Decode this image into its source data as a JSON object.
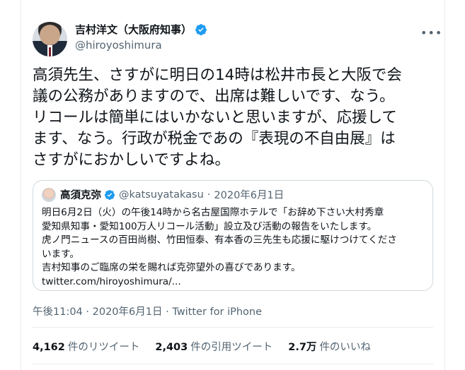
{
  "author": {
    "display_name": "吉村洋文（大阪府知事）",
    "handle": "@hiroyoshimura"
  },
  "more_label": "•••",
  "tweet": {
    "text": "高須先生、さすがに明日の14時は松井市長と大阪で会\n議の公務がありますので、出席は難しいです、なう。\nリコールは簡単にはいかないと思いますが、応援して\nます、なう。行政が税金であの『表現の不自由展』は\nさすがにおかしいですよね。"
  },
  "quoted": {
    "display_name": "高須克弥",
    "handle": "@katsuyatakasu",
    "separator": "·",
    "date": "2020年6月1日",
    "text": "明日6月2日（火）の午後14時から名古屋国際ホテルで「お辞め下さい大村秀章\n愛知県知事・愛知100万人リコール活動」設立及び活動の報告をいたします。\n虎ノ門ニュースの百田尚樹、竹田恒泰、有本香の三先生も応援に駆けつけてくださ\nいます。\n吉村知事のご臨席の栄を賜れば克弥望外の喜びであります。\ntwitter.com/hiroyoshimura/..."
  },
  "timestamp": {
    "time": "午後11:04",
    "separator1": "·",
    "date": "2020年6月1日",
    "separator2": "·",
    "source": "Twitter for iPhone"
  },
  "stats": {
    "retweets_count": "4,162",
    "retweets_label": "件のリツイート",
    "quotes_count": "2,403",
    "quotes_label": "件の引用ツイート",
    "likes_count": "2.7万",
    "likes_label": "件のいいね"
  },
  "colors": {
    "verified_blue": "#1d9bf0",
    "text_primary": "#0f1419",
    "text_secondary": "#536471",
    "border": "#cfd9de"
  }
}
